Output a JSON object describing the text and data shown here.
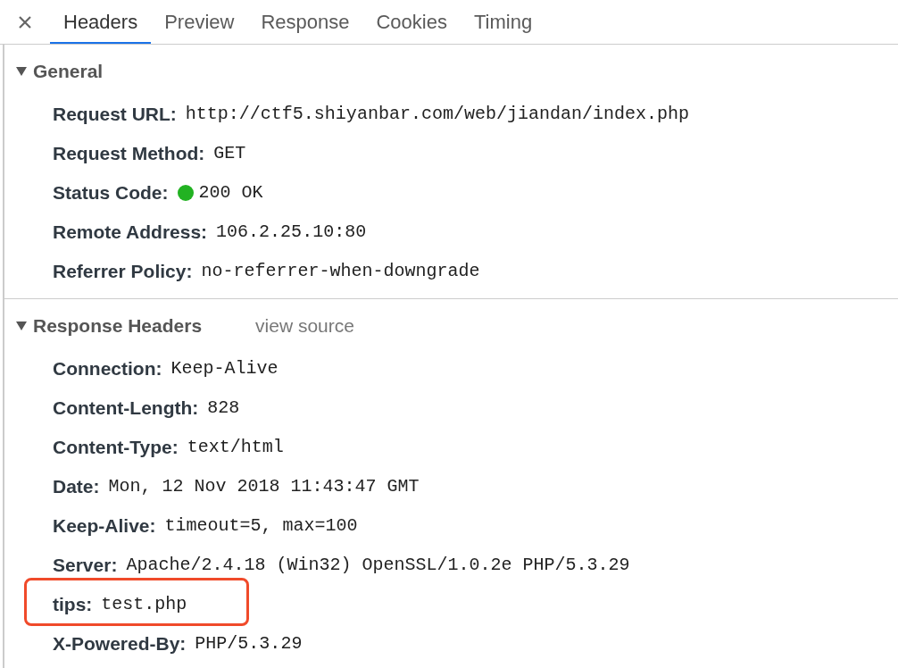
{
  "tabs": [
    {
      "label": "Headers",
      "selected": true
    },
    {
      "label": "Preview",
      "selected": false
    },
    {
      "label": "Response",
      "selected": false
    },
    {
      "label": "Cookies",
      "selected": false
    },
    {
      "label": "Timing",
      "selected": false
    }
  ],
  "sections": [
    {
      "title": "General",
      "expanded": true,
      "rows": [
        {
          "name": "Request URL:",
          "value": "http://ctf5.shiyanbar.com/web/jiandan/index.php"
        },
        {
          "name": "Request Method:",
          "value": "GET"
        },
        {
          "name": "Status Code:",
          "value": "200 OK",
          "color": "#22b222"
        },
        {
          "name": "Remote Address:",
          "value": "106.2.25.10:80"
        },
        {
          "name": "Referrer Policy:",
          "value": "no-referrer-when-downgrade"
        }
      ]
    },
    {
      "title": "Response Headers",
      "expanded": true,
      "link": "view source",
      "rows": [
        {
          "name": "Connection:",
          "value": "Keep-Alive"
        },
        {
          "name": "Content-Length:",
          "value": "828"
        },
        {
          "name": "Content-Type:",
          "value": "text/html"
        },
        {
          "name": "Date:",
          "value": "Mon, 12 Nov 2018 11:43:47 GMT"
        },
        {
          "name": "Keep-Alive:",
          "value": "timeout=5, max=100"
        },
        {
          "name": "Server:",
          "value": "Apache/2.4.18 (Win32) OpenSSL/1.0.2e PHP/5.3.29"
        },
        {
          "name": "tips:",
          "value": "test.php",
          "highlighted": true
        },
        {
          "name": "X-Powered-By:",
          "value": "PHP/5.3.29"
        }
      ]
    }
  ]
}
